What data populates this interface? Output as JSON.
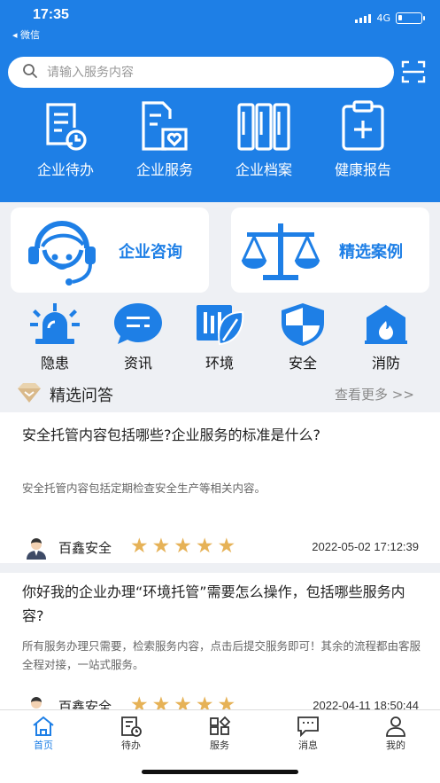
{
  "status": {
    "time": "17:35",
    "back_label": "◂ 微信",
    "network": "4G"
  },
  "search": {
    "placeholder": "请输入服务内容",
    "icon": "search-icon",
    "scan_icon": "scan-icon"
  },
  "top_nav": [
    {
      "label": "企业待办",
      "icon": "todo-clock-icon"
    },
    {
      "label": "企业服务",
      "icon": "service-heart-icon"
    },
    {
      "label": "企业档案",
      "icon": "archive-books-icon"
    },
    {
      "label": "健康报告",
      "icon": "clipboard-plus-icon"
    }
  ],
  "cards": {
    "consult_label": "企业咨询",
    "cases_label": "精选案例"
  },
  "categories": [
    {
      "label": "隐患",
      "icon": "alarm-light-icon"
    },
    {
      "label": "资讯",
      "icon": "chat-bubble-icon"
    },
    {
      "label": "环境",
      "icon": "leaf-panel-icon"
    },
    {
      "label": "安全",
      "icon": "shield-icon"
    },
    {
      "label": "消防",
      "icon": "fire-house-icon"
    }
  ],
  "qa_section": {
    "title": "精选问答",
    "more": "查看更多 >>"
  },
  "qa_items": [
    {
      "question": "安全托管内容包括哪些?企业服务的标准是什么?",
      "answer": "安全托管内容包括定期检查安全生产等相关内容。",
      "author": "百鑫安全",
      "rating": 5,
      "date": "2022-05-02 17:12:39"
    },
    {
      "question": "你好我的企业办理“环境托管”需要怎么操作，包括哪些服务内容?",
      "answer": "所有服务办理只需要，检索服务内容，点击后提交服务即可！其余的流程都由客服全程对接，一站式服务。",
      "author": "百鑫安全",
      "rating": 5,
      "date": "2022-04-11 18:50:44"
    }
  ],
  "tabbar": [
    {
      "label": "首页",
      "icon": "home-icon",
      "active": true
    },
    {
      "label": "待办",
      "icon": "todo-icon",
      "active": false
    },
    {
      "label": "服务",
      "icon": "grid-icon",
      "active": false
    },
    {
      "label": "消息",
      "icon": "message-icon",
      "active": false
    },
    {
      "label": "我的",
      "icon": "user-icon",
      "active": false
    }
  ],
  "colors": {
    "primary": "#1e7fe6",
    "star": "#e6b257",
    "background": "#eef0f4"
  }
}
